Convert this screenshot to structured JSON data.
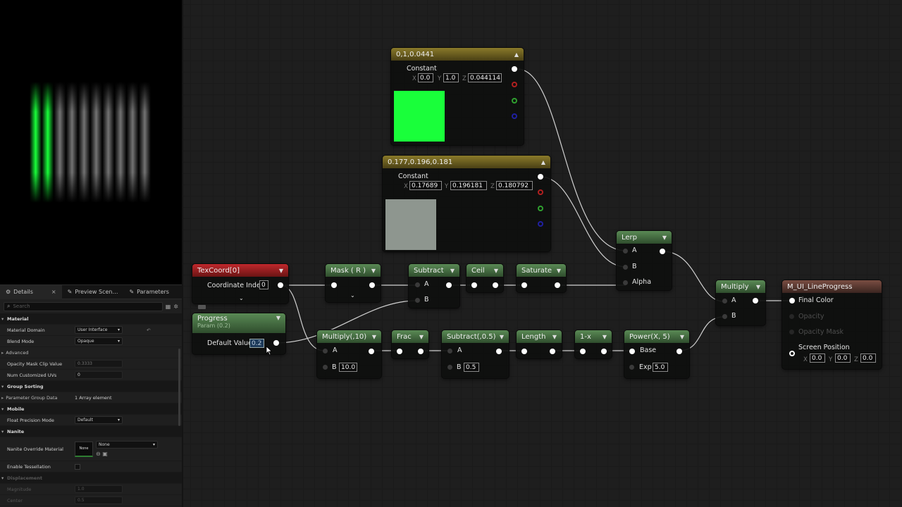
{
  "preview": {
    "stripes_color": "#19ff3a"
  },
  "details": {
    "tabs": [
      {
        "label": "Details",
        "icon": "details-icon",
        "close": "×"
      },
      {
        "label": "Preview Scen…",
        "icon": "preview-scene-icon"
      },
      {
        "label": "Parameters",
        "icon": "parameters-icon"
      }
    ],
    "search_placeholder": "Search",
    "rows": {
      "material": "Material",
      "material_domain_label": "Material Domain",
      "material_domain_value": "User Interface",
      "blend_mode_label": "Blend Mode",
      "blend_mode_value": "Opaque",
      "advanced": "Advanced",
      "opacity_clip_label": "Opacity Mask Clip Value",
      "opacity_clip_value": "0.3333",
      "num_uvs_label": "Num Customized UVs",
      "num_uvs_value": "0",
      "group_sorting": "Group Sorting",
      "param_group_label": "Parameter Group Data",
      "param_group_value": "1 Array element",
      "mobile": "Mobile",
      "float_precision_label": "Float Precision Mode",
      "float_precision_value": "Default",
      "nanite": "Nanite",
      "nanite_override_label": "Nanite Override Material",
      "nanite_thumb": "None",
      "nanite_value": "None",
      "enable_tess_label": "Enable Tessellation",
      "displacement": "Displacement",
      "magnitude_label": "Magnitude",
      "magnitude_value": "1.0",
      "center_label": "Center",
      "center_value": "0.5"
    }
  },
  "nodes": {
    "constant1": {
      "title": "0,1,0.0441",
      "label": "Constant",
      "x": "0.0",
      "y": "1.0",
      "z": "0.044114",
      "color": "#19ff3a"
    },
    "constant2": {
      "title": "0.177,0.196,0.181",
      "label": "Constant",
      "x": "0.17689",
      "y": "0.196181",
      "z": "0.180792",
      "color": "#8e968f"
    },
    "texcoord": {
      "title": "TexCoord[0]",
      "label": "Coordinate Index",
      "value": "0"
    },
    "progress": {
      "title": "Progress",
      "subtitle": "Param (0.2)",
      "label": "Default Value",
      "value": "0.2"
    },
    "mask": {
      "title": "Mask ( R )"
    },
    "subtract": {
      "title": "Subtract",
      "a": "A",
      "b": "B"
    },
    "ceil": {
      "title": "Ceil"
    },
    "saturate": {
      "title": "Saturate"
    },
    "lerp": {
      "title": "Lerp",
      "a": "A",
      "b": "B",
      "alpha": "Alpha"
    },
    "multiply10": {
      "title": "Multiply(,10)",
      "a": "A",
      "b": "B",
      "b_value": "10.0"
    },
    "frac": {
      "title": "Frac"
    },
    "subtract05": {
      "title": "Subtract(,0.5)",
      "a": "A",
      "b": "B",
      "b_value": "0.5"
    },
    "length": {
      "title": "Length"
    },
    "oneminus": {
      "title": "1-x"
    },
    "power": {
      "title": "Power(X, 5)",
      "base": "Base",
      "exp": "Exp",
      "exp_value": "5.0"
    },
    "multiply": {
      "title": "Multiply",
      "a": "A",
      "b": "B"
    },
    "result": {
      "title": "M_UI_LineProgress",
      "final_color": "Final Color",
      "opacity": "Opacity",
      "opacity_mask": "Opacity Mask",
      "screen_position": "Screen Position",
      "x": "0.0",
      "y": "0.0",
      "z": "0.0"
    }
  },
  "axis_labels": {
    "x": "X",
    "y": "Y",
    "z": "Z"
  }
}
